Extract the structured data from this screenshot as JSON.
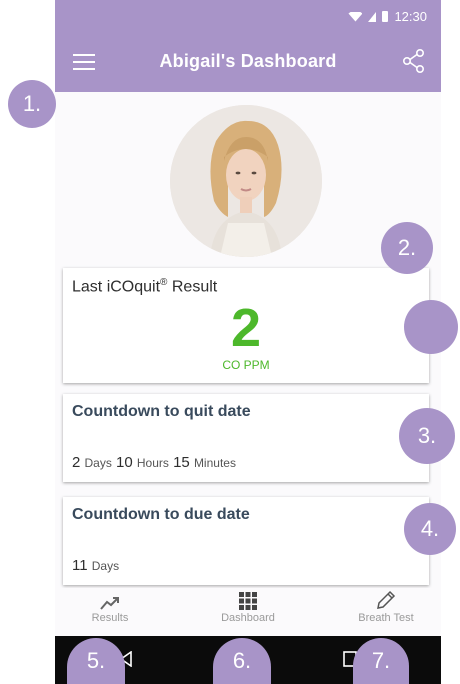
{
  "status_bar": {
    "time": "12:30"
  },
  "app_bar": {
    "title": "Abigail's Dashboard"
  },
  "result_card": {
    "title": "Last iCOquit",
    "reg_mark": "®",
    "title_suffix": " Result",
    "value": "2",
    "unit": "CO PPM"
  },
  "quit_card": {
    "title": "Countdown to quit date",
    "days_value": "2",
    "days_label": "Days",
    "hours_value": "10",
    "hours_label": "Hours",
    "minutes_value": "15",
    "minutes_label": "Minutes"
  },
  "due_card": {
    "title": "Countdown to due date",
    "days_value": "11",
    "days_label": "Days"
  },
  "bottom_nav": [
    {
      "label": "Results",
      "icon": "trending-up-icon"
    },
    {
      "label": "Dashboard",
      "icon": "grid-icon"
    },
    {
      "label": "Breath Test",
      "icon": "pen-icon"
    }
  ],
  "markers": [
    "1.",
    "2.",
    "",
    "3.",
    "4.",
    "5.",
    "6.",
    "7."
  ],
  "colors": {
    "accent": "#a894c8",
    "result_green": "#4db82b",
    "title_text": "#394a5c",
    "system_nav": "#0b0b0b"
  }
}
